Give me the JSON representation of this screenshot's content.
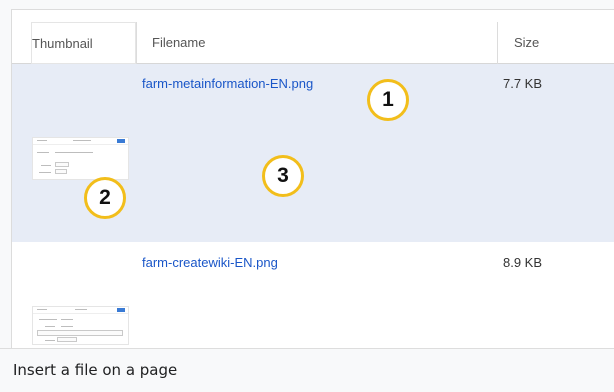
{
  "table": {
    "columns": {
      "thumbnail": "Thumbnail",
      "filename": "Filename",
      "size": "Size"
    },
    "rows": [
      {
        "filename": "farm-metainformation-EN.png",
        "size": "7.7 KB",
        "selected": true
      },
      {
        "filename": "farm-createwiki-EN.png",
        "size": "8.9 KB",
        "selected": false
      }
    ]
  },
  "callouts": [
    "1",
    "2",
    "3"
  ],
  "caption": "Insert a file on a page",
  "colors": {
    "link": "#1a56c8",
    "selected_row": "#e7ecf6",
    "callout_ring": "#f2be1b"
  }
}
